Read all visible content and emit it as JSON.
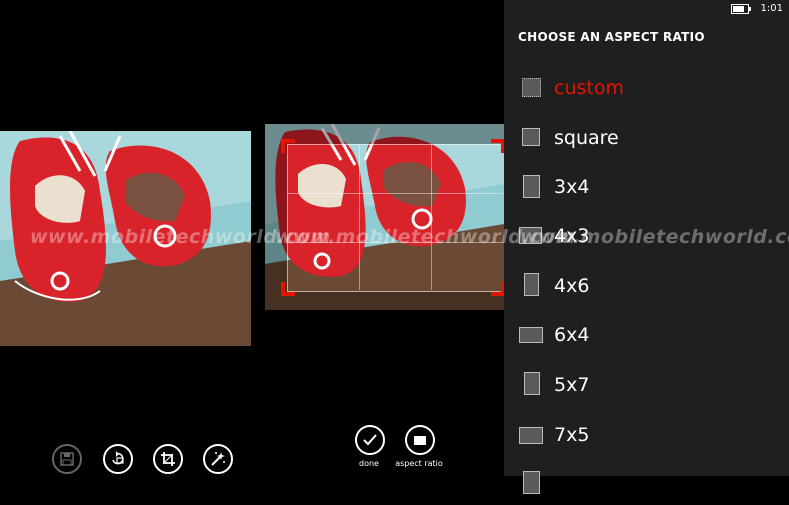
{
  "watermark": "www.mobiletechworld.com",
  "toolbar": {
    "done_label": "done",
    "aspect_label": "aspect ratio"
  },
  "status_bar": {
    "time": "1:01",
    "battery_level": 0.8
  },
  "panel": {
    "title": "CHOOSE AN ASPECT RATIO",
    "items": [
      {
        "label": "custom"
      },
      {
        "label": "square"
      },
      {
        "label": "3x4"
      },
      {
        "label": "4x3"
      },
      {
        "label": "4x6"
      },
      {
        "label": "6x4"
      },
      {
        "label": "5x7"
      },
      {
        "label": "7x5"
      }
    ],
    "selected_index": 0
  },
  "colors": {
    "accent": "#e51400",
    "panel_bg": "#1f1f1f",
    "background": "#000000"
  }
}
